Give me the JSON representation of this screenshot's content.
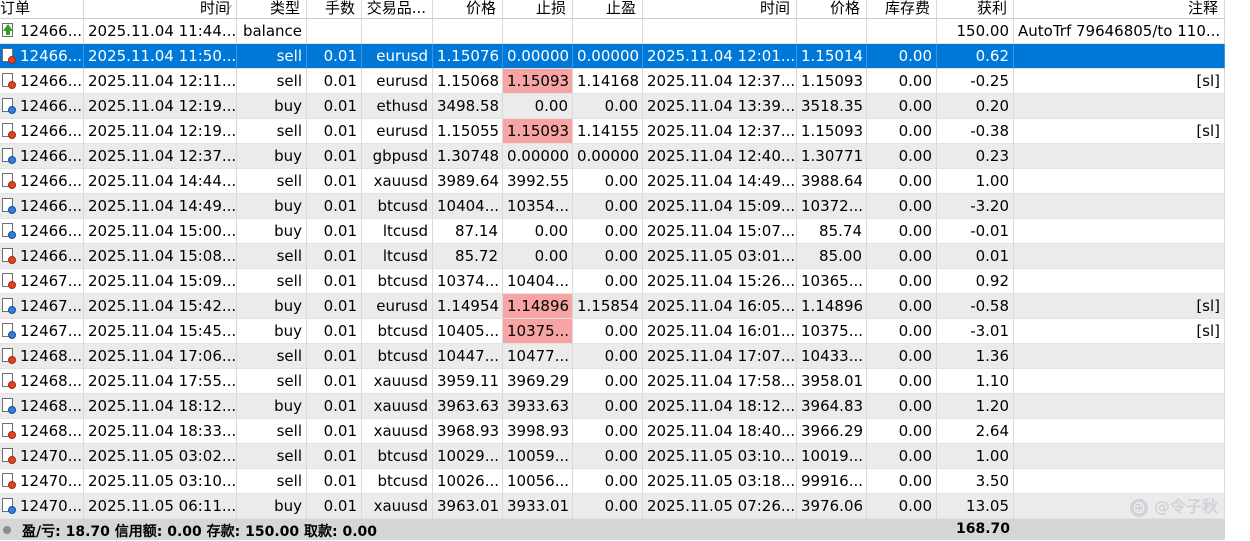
{
  "columns": [
    "订单",
    "时间",
    "类型",
    "手数",
    "交易品...",
    "价格",
    "止损",
    "止盈",
    "时间",
    "价格",
    "库存费",
    "获利",
    "注释"
  ],
  "sort_indicator": "⁄",
  "rows": [
    {
      "order": "12466...",
      "open_time": "2025.11.04 11:44...",
      "type": "balance",
      "lots": "",
      "symbol": "",
      "open_price": "",
      "sl": "",
      "tp": "",
      "close_time": "",
      "close_price": "",
      "swap": "",
      "profit": "150.00",
      "comment": "AutoTrf 79646805/to 110...",
      "icon": "deposit"
    },
    {
      "order": "12466...",
      "open_time": "2025.11.04 11:50...",
      "type": "sell",
      "lots": "0.01",
      "symbol": "eurusd",
      "open_price": "1.15076",
      "sl": "0.00000",
      "tp": "0.00000",
      "close_time": "2025.11.04 12:01...",
      "close_price": "1.15014",
      "swap": "0.00",
      "profit": "0.62",
      "comment": "",
      "icon": "sell",
      "selected": true
    },
    {
      "order": "12466...",
      "open_time": "2025.11.04 12:11...",
      "type": "sell",
      "lots": "0.01",
      "symbol": "eurusd",
      "open_price": "1.15068",
      "sl": "1.15093",
      "tp": "1.14168",
      "close_time": "2025.11.04 12:37...",
      "close_price": "1.15093",
      "swap": "0.00",
      "profit": "-0.25",
      "comment": "[sl]",
      "icon": "sell",
      "sl_hit": true
    },
    {
      "order": "12466...",
      "open_time": "2025.11.04 12:19...",
      "type": "buy",
      "lots": "0.01",
      "symbol": "ethusd",
      "open_price": "3498.58",
      "sl": "0.00",
      "tp": "0.00",
      "close_time": "2025.11.04 13:39...",
      "close_price": "3518.35",
      "swap": "0.00",
      "profit": "0.20",
      "comment": "",
      "icon": "buy"
    },
    {
      "order": "12466...",
      "open_time": "2025.11.04 12:19...",
      "type": "sell",
      "lots": "0.01",
      "symbol": "eurusd",
      "open_price": "1.15055",
      "sl": "1.15093",
      "tp": "1.14155",
      "close_time": "2025.11.04 12:37...",
      "close_price": "1.15093",
      "swap": "0.00",
      "profit": "-0.38",
      "comment": "[sl]",
      "icon": "sell",
      "sl_hit": true
    },
    {
      "order": "12466...",
      "open_time": "2025.11.04 12:37...",
      "type": "buy",
      "lots": "0.01",
      "symbol": "gbpusd",
      "open_price": "1.30748",
      "sl": "0.00000",
      "tp": "0.00000",
      "close_time": "2025.11.04 12:40...",
      "close_price": "1.30771",
      "swap": "0.00",
      "profit": "0.23",
      "comment": "",
      "icon": "buy"
    },
    {
      "order": "12466...",
      "open_time": "2025.11.04 14:44...",
      "type": "sell",
      "lots": "0.01",
      "symbol": "xauusd",
      "open_price": "3989.64",
      "sl": "3992.55",
      "tp": "0.00",
      "close_time": "2025.11.04 14:49...",
      "close_price": "3988.64",
      "swap": "0.00",
      "profit": "1.00",
      "comment": "",
      "icon": "sell"
    },
    {
      "order": "12466...",
      "open_time": "2025.11.04 14:49...",
      "type": "buy",
      "lots": "0.01",
      "symbol": "btcusd",
      "open_price": "10404...",
      "sl": "10354...",
      "tp": "0.00",
      "close_time": "2025.11.04 15:09...",
      "close_price": "10372...",
      "swap": "0.00",
      "profit": "-3.20",
      "comment": "",
      "icon": "buy"
    },
    {
      "order": "12466...",
      "open_time": "2025.11.04 15:00...",
      "type": "buy",
      "lots": "0.01",
      "symbol": "ltcusd",
      "open_price": "87.14",
      "sl": "0.00",
      "tp": "0.00",
      "close_time": "2025.11.04 15:07...",
      "close_price": "85.74",
      "swap": "0.00",
      "profit": "-0.01",
      "comment": "",
      "icon": "buy"
    },
    {
      "order": "12466...",
      "open_time": "2025.11.04 15:08...",
      "type": "sell",
      "lots": "0.01",
      "symbol": "ltcusd",
      "open_price": "85.72",
      "sl": "0.00",
      "tp": "0.00",
      "close_time": "2025.11.05 03:01...",
      "close_price": "85.00",
      "swap": "0.00",
      "profit": "0.01",
      "comment": "",
      "icon": "sell"
    },
    {
      "order": "12467...",
      "open_time": "2025.11.04 15:09...",
      "type": "sell",
      "lots": "0.01",
      "symbol": "btcusd",
      "open_price": "10374...",
      "sl": "10404...",
      "tp": "0.00",
      "close_time": "2025.11.04 15:26...",
      "close_price": "10365...",
      "swap": "0.00",
      "profit": "0.92",
      "comment": "",
      "icon": "sell"
    },
    {
      "order": "12467...",
      "open_time": "2025.11.04 15:42...",
      "type": "buy",
      "lots": "0.01",
      "symbol": "eurusd",
      "open_price": "1.14954",
      "sl": "1.14896",
      "tp": "1.15854",
      "close_time": "2025.11.04 16:05...",
      "close_price": "1.14896",
      "swap": "0.00",
      "profit": "-0.58",
      "comment": "[sl]",
      "icon": "buy",
      "sl_hit": true
    },
    {
      "order": "12467...",
      "open_time": "2025.11.04 15:45...",
      "type": "buy",
      "lots": "0.01",
      "symbol": "btcusd",
      "open_price": "10405...",
      "sl": "10375...",
      "tp": "0.00",
      "close_time": "2025.11.04 16:01...",
      "close_price": "10375...",
      "swap": "0.00",
      "profit": "-3.01",
      "comment": "[sl]",
      "icon": "buy",
      "sl_hit": true
    },
    {
      "order": "12468...",
      "open_time": "2025.11.04 17:06...",
      "type": "sell",
      "lots": "0.01",
      "symbol": "btcusd",
      "open_price": "10447...",
      "sl": "10477...",
      "tp": "0.00",
      "close_time": "2025.11.04 17:07...",
      "close_price": "10433...",
      "swap": "0.00",
      "profit": "1.36",
      "comment": "",
      "icon": "sell"
    },
    {
      "order": "12468...",
      "open_time": "2025.11.04 17:55...",
      "type": "sell",
      "lots": "0.01",
      "symbol": "xauusd",
      "open_price": "3959.11",
      "sl": "3969.29",
      "tp": "0.00",
      "close_time": "2025.11.04 17:58...",
      "close_price": "3958.01",
      "swap": "0.00",
      "profit": "1.10",
      "comment": "",
      "icon": "sell"
    },
    {
      "order": "12468...",
      "open_time": "2025.11.04 18:12...",
      "type": "buy",
      "lots": "0.01",
      "symbol": "xauusd",
      "open_price": "3963.63",
      "sl": "3933.63",
      "tp": "0.00",
      "close_time": "2025.11.04 18:12...",
      "close_price": "3964.83",
      "swap": "0.00",
      "profit": "1.20",
      "comment": "",
      "icon": "buy"
    },
    {
      "order": "12468...",
      "open_time": "2025.11.04 18:33...",
      "type": "sell",
      "lots": "0.01",
      "symbol": "xauusd",
      "open_price": "3968.93",
      "sl": "3998.93",
      "tp": "0.00",
      "close_time": "2025.11.04 18:40...",
      "close_price": "3966.29",
      "swap": "0.00",
      "profit": "2.64",
      "comment": "",
      "icon": "sell"
    },
    {
      "order": "12470...",
      "open_time": "2025.11.05 03:02...",
      "type": "sell",
      "lots": "0.01",
      "symbol": "btcusd",
      "open_price": "10029...",
      "sl": "10059...",
      "tp": "0.00",
      "close_time": "2025.11.05 03:10...",
      "close_price": "10019...",
      "swap": "0.00",
      "profit": "1.00",
      "comment": "",
      "icon": "sell"
    },
    {
      "order": "12470...",
      "open_time": "2025.11.05 03:10...",
      "type": "sell",
      "lots": "0.01",
      "symbol": "btcusd",
      "open_price": "10026...",
      "sl": "10056...",
      "tp": "0.00",
      "close_time": "2025.11.05 03:18...",
      "close_price": "99916...",
      "swap": "0.00",
      "profit": "3.50",
      "comment": "",
      "icon": "sell"
    },
    {
      "order": "12470...",
      "open_time": "2025.11.05 06:11...",
      "type": "buy",
      "lots": "0.01",
      "symbol": "xauusd",
      "open_price": "3963.01",
      "sl": "3933.01",
      "tp": "0.00",
      "close_time": "2025.11.05 07:26...",
      "close_price": "3976.06",
      "swap": "0.00",
      "profit": "13.05",
      "comment": "",
      "icon": "buy"
    }
  ],
  "footer": {
    "summary": "盈/亏: 18.70  信用额: 0.00  存款: 150.00  取款: 0.00",
    "total_profit": "168.70"
  },
  "watermark": {
    "text": "@令子秋"
  },
  "colors": {
    "selected_row": "#0078d7",
    "sl_hit": "#f7a4a4",
    "alt_row": "#ebebeb",
    "footer": "#d6d6d6"
  }
}
